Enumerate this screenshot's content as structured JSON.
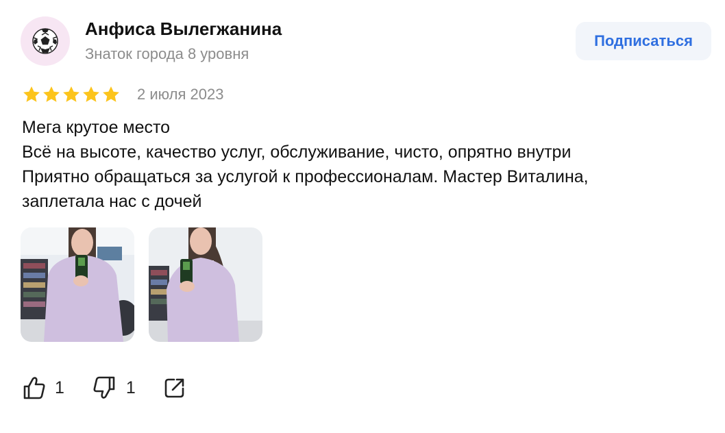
{
  "author": {
    "name": "Анфиса Вылегжанина",
    "level": "Знаток города 8 уровня",
    "avatar_icon": "soccer-ball-icon"
  },
  "subscribe": {
    "label": "Подписаться"
  },
  "rating": {
    "stars": 5,
    "max": 5,
    "color": "#fcc41c"
  },
  "date": "2 июля 2023",
  "review": {
    "lines": [
      "Мега крутое место",
      "Всё на высоте, качество услуг, обслуживание, чисто, опрятно внутри",
      "Приятно обращаться за услугой к профессионалам. Мастер Виталина,",
      "заплетала нас с дочей"
    ]
  },
  "photos": [
    {
      "name": "review-photo-1"
    },
    {
      "name": "review-photo-2"
    }
  ],
  "actions": {
    "likes": "1",
    "dislikes": "1",
    "like_icon": "thumbs-up-icon",
    "dislike_icon": "thumbs-down-icon",
    "share_icon": "share-icon"
  },
  "colors": {
    "accent": "#2f6fe0",
    "button_bg": "#f2f5fa",
    "muted_text": "#8c8c8c",
    "avatar_bg": "#f7e6f3"
  }
}
